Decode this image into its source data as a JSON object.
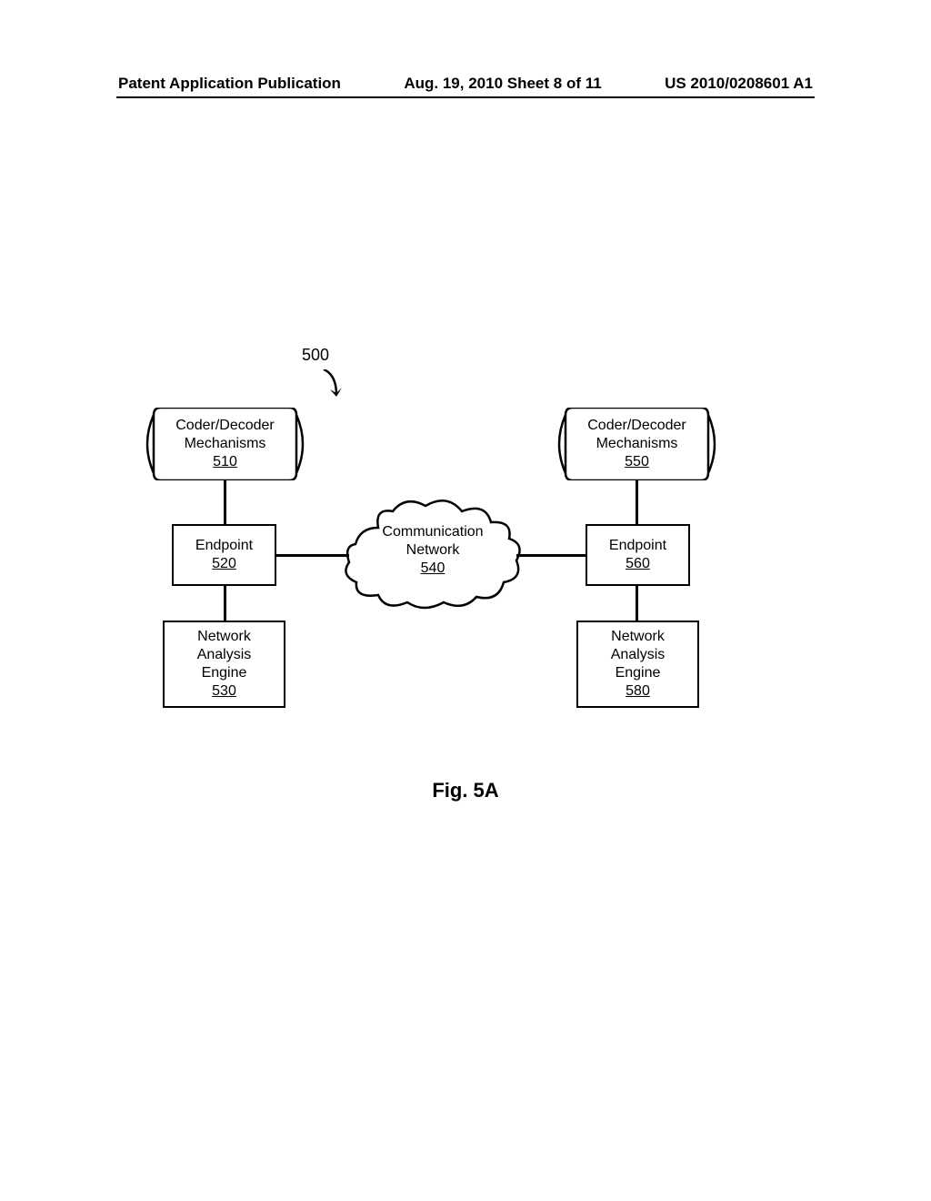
{
  "header": {
    "left": "Patent Application Publication",
    "center": "Aug. 19, 2010  Sheet 8 of 11",
    "right": "US 2010/0208601 A1"
  },
  "diagram": {
    "refNumber": "500",
    "coderLeft": {
      "line1": "Coder/Decoder",
      "line2": "Mechanisms",
      "ref": "510"
    },
    "coderRight": {
      "line1": "Coder/Decoder",
      "line2": "Mechanisms",
      "ref": "550"
    },
    "endpointLeft": {
      "label": "Endpoint",
      "ref": "520"
    },
    "endpointRight": {
      "label": "Endpoint",
      "ref": "560"
    },
    "analysisLeft": {
      "line1": "Network",
      "line2": "Analysis",
      "line3": "Engine",
      "ref": "530"
    },
    "analysisRight": {
      "line1": "Network",
      "line2": "Analysis",
      "line3": "Engine",
      "ref": "580"
    },
    "cloud": {
      "line1": "Communication",
      "line2": "Network",
      "ref": "540"
    },
    "figLabel": "Fig. 5A"
  }
}
